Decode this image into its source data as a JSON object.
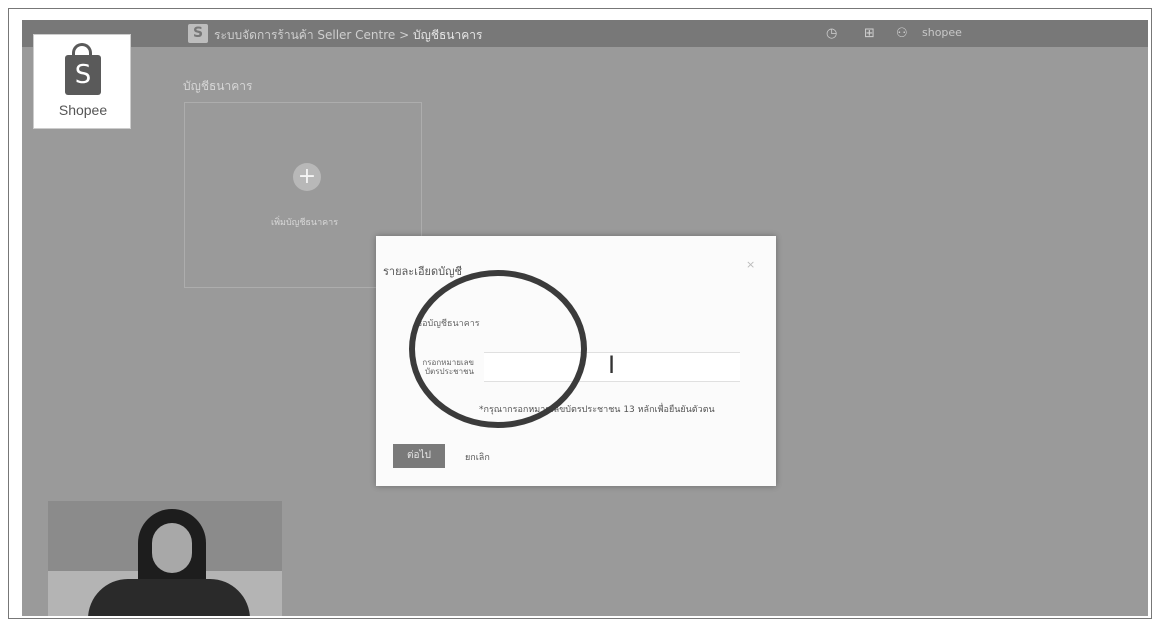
{
  "app": {
    "title_prefix": "ระบบจัดการร้านค้า Seller Centre >",
    "title_current": "บัญชีธนาคาร",
    "user_name": "shopee"
  },
  "logo": {
    "text": "Shopee",
    "glyph": "S"
  },
  "page": {
    "heading": "บัญชีธนาคาร",
    "add_card_icon": "+",
    "add_card_label": "เพิ่มบัญชีธนาคาร"
  },
  "modal": {
    "title": "รายละเอียดบัญชี",
    "close": "×",
    "field1_label": "ชื่อบัญชีธนาคาร",
    "field2_label": "กรอกหมายเลขบัตรประชาชน",
    "field2_value": "",
    "note": "*กรุณากรอกหมายเลขบัตรประชาชน 13 หลักเพื่อยืนยันตัวตน",
    "save_label": "ต่อไป",
    "cancel_label": "ยกเลิก"
  },
  "icons": {
    "header_icon_1": "clock-icon",
    "header_icon_2": "grid-icon",
    "header_icon_3": "user-icon"
  }
}
